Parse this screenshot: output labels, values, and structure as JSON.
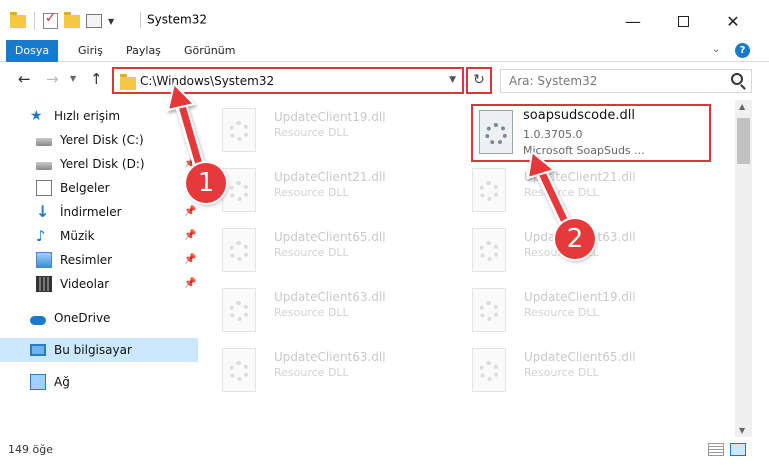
{
  "window": {
    "title": "System32",
    "minimize_glyph": "—",
    "close_glyph": "✕"
  },
  "ribbon": {
    "tabs": [
      "Dosya",
      "Giriş",
      "Paylaş",
      "Görünüm"
    ],
    "help_glyph": "?"
  },
  "nav": {
    "back_glyph": "←",
    "forward_glyph": "→",
    "up_glyph": "↑",
    "address": "C:\\Windows\\System32",
    "refresh_glyph": "↻",
    "search_placeholder": "Ara: System32"
  },
  "sidebar": {
    "items": [
      {
        "label": "Hızlı erişim",
        "icon": "star-icon"
      },
      {
        "label": "Yerel Disk (C:)",
        "icon": "drive-icon",
        "pinned": true
      },
      {
        "label": "Yerel Disk (D:)",
        "icon": "drive-icon",
        "pinned": true
      },
      {
        "label": "Belgeler",
        "icon": "document-icon",
        "pinned": true
      },
      {
        "label": "İndirmeler",
        "icon": "download-icon",
        "pinned": true
      },
      {
        "label": "Müzik",
        "icon": "music-icon",
        "pinned": true
      },
      {
        "label": "Resimler",
        "icon": "pictures-icon",
        "pinned": true
      },
      {
        "label": "Videolar",
        "icon": "video-icon",
        "pinned": true
      },
      {
        "label": "OneDrive",
        "icon": "cloud-icon"
      },
      {
        "label": "Bu bilgisayar",
        "icon": "computer-icon",
        "selected": true
      },
      {
        "label": "Ağ",
        "icon": "network-icon"
      }
    ]
  },
  "files": {
    "left_column": [
      {
        "name": "UpdateClient19.dll",
        "type": "Resource DLL"
      },
      {
        "name": "UpdateClient21.dll",
        "type": "Resource DLL"
      },
      {
        "name": "UpdateClient65.dll",
        "type": "Resource DLL"
      },
      {
        "name": "UpdateClient63.dll",
        "type": "Resource DLL"
      },
      {
        "name": "UpdateClient63.dll",
        "type": "Resource DLL"
      }
    ],
    "right_column": [
      {
        "name": "UpdateClient21.dll",
        "type": "Resource DLL"
      },
      {
        "name": "UpdateClient63.dll",
        "type": "Resource DLL"
      },
      {
        "name": "UpdateClient19.dll",
        "type": "Resource DLL"
      },
      {
        "name": "UpdateClient65.dll",
        "type": "Resource DLL"
      }
    ],
    "highlighted": {
      "name": "soapsudscode.dll",
      "version": "1.0.3705.0",
      "description": "Microsoft SoapSuds ..."
    }
  },
  "status": {
    "item_count": "149 öğe"
  },
  "annotations": {
    "badge_1": "1",
    "badge_2": "2",
    "color": "#e6393a"
  }
}
